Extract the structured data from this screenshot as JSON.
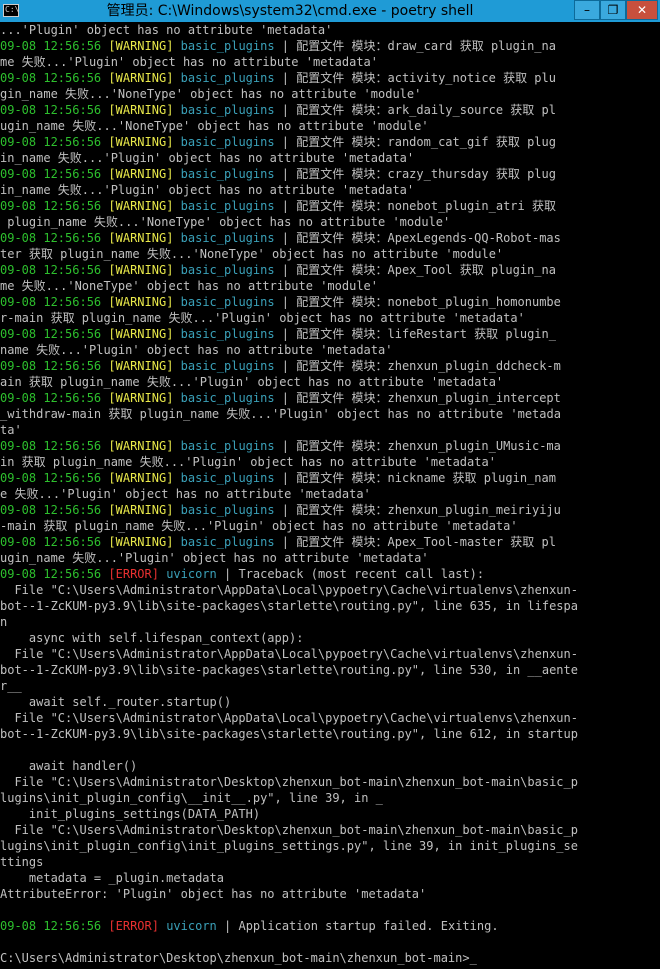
{
  "window": {
    "title": "管理员: C:\\Windows\\system32\\cmd.exe - poetry  shell",
    "icon_label": "C:\\",
    "buttons": {
      "minimize": "–",
      "restore": "❐",
      "close": "✕"
    }
  },
  "colors": {
    "background": "#000000",
    "time": "#2dbf2d",
    "warning": "#e8e84a",
    "error": "#e83030",
    "source": "#3aa0b8",
    "text": "#c0c0c0"
  },
  "console": {
    "lines": [
      {
        "kind": "plain",
        "text": "...'Plugin' object has no attribute 'metadata'"
      },
      {
        "kind": "log",
        "time": "09-08 12:56:56",
        "level": "[WARNING]",
        "source": "basic_plugins",
        "sep": " | ",
        "msg": "配置文件 模块：draw_card 获取 plugin_na"
      },
      {
        "kind": "plain",
        "text": "me 失败...'Plugin' object has no attribute 'metadata'"
      },
      {
        "kind": "log",
        "time": "09-08 12:56:56",
        "level": "[WARNING]",
        "source": "basic_plugins",
        "sep": " | ",
        "msg": "配置文件 模块：activity_notice 获取 plu"
      },
      {
        "kind": "plain",
        "text": "gin_name 失败...'NoneType' object has no attribute 'module'"
      },
      {
        "kind": "log",
        "time": "09-08 12:56:56",
        "level": "[WARNING]",
        "source": "basic_plugins",
        "sep": " | ",
        "msg": "配置文件 模块：ark_daily_source 获取 pl"
      },
      {
        "kind": "plain",
        "text": "ugin_name 失败...'NoneType' object has no attribute 'module'"
      },
      {
        "kind": "log",
        "time": "09-08 12:56:56",
        "level": "[WARNING]",
        "source": "basic_plugins",
        "sep": " | ",
        "msg": "配置文件 模块：random_cat_gif 获取 plug"
      },
      {
        "kind": "plain",
        "text": "in_name 失败...'Plugin' object has no attribute 'metadata'"
      },
      {
        "kind": "log",
        "time": "09-08 12:56:56",
        "level": "[WARNING]",
        "source": "basic_plugins",
        "sep": " | ",
        "msg": "配置文件 模块：crazy_thursday 获取 plug"
      },
      {
        "kind": "plain",
        "text": "in_name 失败...'Plugin' object has no attribute 'metadata'"
      },
      {
        "kind": "log",
        "time": "09-08 12:56:56",
        "level": "[WARNING]",
        "source": "basic_plugins",
        "sep": " | ",
        "msg": "配置文件 模块：nonebot_plugin_atri 获取"
      },
      {
        "kind": "plain",
        "text": " plugin_name 失败...'NoneType' object has no attribute 'module'"
      },
      {
        "kind": "log",
        "time": "09-08 12:56:56",
        "level": "[WARNING]",
        "source": "basic_plugins",
        "sep": " | ",
        "msg": "配置文件 模块：ApexLegends-QQ-Robot-mas"
      },
      {
        "kind": "plain",
        "text": "ter 获取 plugin_name 失败...'NoneType' object has no attribute 'module'"
      },
      {
        "kind": "log",
        "time": "09-08 12:56:56",
        "level": "[WARNING]",
        "source": "basic_plugins",
        "sep": " | ",
        "msg": "配置文件 模块：Apex_Tool 获取 plugin_na"
      },
      {
        "kind": "plain",
        "text": "me 失败...'NoneType' object has no attribute 'module'"
      },
      {
        "kind": "log",
        "time": "09-08 12:56:56",
        "level": "[WARNING]",
        "source": "basic_plugins",
        "sep": " | ",
        "msg": "配置文件 模块：nonebot_plugin_homonumbe"
      },
      {
        "kind": "plain",
        "text": "r-main 获取 plugin_name 失败...'Plugin' object has no attribute 'metadata'"
      },
      {
        "kind": "log",
        "time": "09-08 12:56:56",
        "level": "[WARNING]",
        "source": "basic_plugins",
        "sep": " | ",
        "msg": "配置文件 模块：lifeRestart 获取 plugin_"
      },
      {
        "kind": "plain",
        "text": "name 失败...'Plugin' object has no attribute 'metadata'"
      },
      {
        "kind": "log",
        "time": "09-08 12:56:56",
        "level": "[WARNING]",
        "source": "basic_plugins",
        "sep": " | ",
        "msg": "配置文件 模块：zhenxun_plugin_ddcheck-m"
      },
      {
        "kind": "plain",
        "text": "ain 获取 plugin_name 失败...'Plugin' object has no attribute 'metadata'"
      },
      {
        "kind": "log",
        "time": "09-08 12:56:56",
        "level": "[WARNING]",
        "source": "basic_plugins",
        "sep": " | ",
        "msg": "配置文件 模块：zhenxun_plugin_intercept"
      },
      {
        "kind": "plain",
        "text": "_withdraw-main 获取 plugin_name 失败...'Plugin' object has no attribute 'metada"
      },
      {
        "kind": "plain",
        "text": "ta'"
      },
      {
        "kind": "log",
        "time": "09-08 12:56:56",
        "level": "[WARNING]",
        "source": "basic_plugins",
        "sep": " | ",
        "msg": "配置文件 模块：zhenxun_plugin_UMusic-ma"
      },
      {
        "kind": "plain",
        "text": "in 获取 plugin_name 失败...'Plugin' object has no attribute 'metadata'"
      },
      {
        "kind": "log",
        "time": "09-08 12:56:56",
        "level": "[WARNING]",
        "source": "basic_plugins",
        "sep": " | ",
        "msg": "配置文件 模块：nickname 获取 plugin_nam"
      },
      {
        "kind": "plain",
        "text": "e 失败...'Plugin' object has no attribute 'metadata'"
      },
      {
        "kind": "log",
        "time": "09-08 12:56:56",
        "level": "[WARNING]",
        "source": "basic_plugins",
        "sep": " | ",
        "msg": "配置文件 模块：zhenxun_plugin_meiriyiju"
      },
      {
        "kind": "plain",
        "text": "-main 获取 plugin_name 失败...'Plugin' object has no attribute 'metadata'"
      },
      {
        "kind": "log",
        "time": "09-08 12:56:56",
        "level": "[WARNING]",
        "source": "basic_plugins",
        "sep": " | ",
        "msg": "配置文件 模块：Apex_Tool-master 获取 pl"
      },
      {
        "kind": "plain",
        "text": "ugin_name 失败...'Plugin' object has no attribute 'metadata'"
      },
      {
        "kind": "log",
        "time": "09-08 12:56:56",
        "level": "[ERROR]",
        "source": "uvicorn",
        "sep": " | ",
        "msg": "Traceback (most recent call last):"
      },
      {
        "kind": "plain",
        "text": "  File \"C:\\Users\\Administrator\\AppData\\Local\\pypoetry\\Cache\\virtualenvs\\zhenxun-"
      },
      {
        "kind": "plain",
        "text": "bot--1-ZcKUM-py3.9\\lib\\site-packages\\starlette\\routing.py\", line 635, in lifespa"
      },
      {
        "kind": "plain",
        "text": "n"
      },
      {
        "kind": "plain",
        "text": "    async with self.lifespan_context(app):"
      },
      {
        "kind": "plain",
        "text": "  File \"C:\\Users\\Administrator\\AppData\\Local\\pypoetry\\Cache\\virtualenvs\\zhenxun-"
      },
      {
        "kind": "plain",
        "text": "bot--1-ZcKUM-py3.9\\lib\\site-packages\\starlette\\routing.py\", line 530, in __aente"
      },
      {
        "kind": "plain",
        "text": "r__"
      },
      {
        "kind": "plain",
        "text": "    await self._router.startup()"
      },
      {
        "kind": "plain",
        "text": "  File \"C:\\Users\\Administrator\\AppData\\Local\\pypoetry\\Cache\\virtualenvs\\zhenxun-"
      },
      {
        "kind": "plain",
        "text": "bot--1-ZcKUM-py3.9\\lib\\site-packages\\starlette\\routing.py\", line 612, in startup"
      },
      {
        "kind": "plain",
        "text": ""
      },
      {
        "kind": "plain",
        "text": "    await handler()"
      },
      {
        "kind": "plain",
        "text": "  File \"C:\\Users\\Administrator\\Desktop\\zhenxun_bot-main\\zhenxun_bot-main\\basic_p"
      },
      {
        "kind": "plain",
        "text": "lugins\\init_plugin_config\\__init__.py\", line 39, in _"
      },
      {
        "kind": "plain",
        "text": "    init_plugins_settings(DATA_PATH)"
      },
      {
        "kind": "plain",
        "text": "  File \"C:\\Users\\Administrator\\Desktop\\zhenxun_bot-main\\zhenxun_bot-main\\basic_p"
      },
      {
        "kind": "plain",
        "text": "lugins\\init_plugin_config\\init_plugins_settings.py\", line 39, in init_plugins_se"
      },
      {
        "kind": "plain",
        "text": "ttings"
      },
      {
        "kind": "plain",
        "text": "    metadata = _plugin.metadata"
      },
      {
        "kind": "plain",
        "text": "AttributeError: 'Plugin' object has no attribute 'metadata'"
      },
      {
        "kind": "plain",
        "text": ""
      },
      {
        "kind": "log",
        "time": "09-08 12:56:56",
        "level": "[ERROR]",
        "source": "uvicorn",
        "sep": " | ",
        "msg": "Application startup failed. Exiting."
      },
      {
        "kind": "plain",
        "text": ""
      },
      {
        "kind": "plain",
        "text": "C:\\Users\\Administrator\\Desktop\\zhenxun_bot-main\\zhenxun_bot-main>_"
      }
    ]
  }
}
